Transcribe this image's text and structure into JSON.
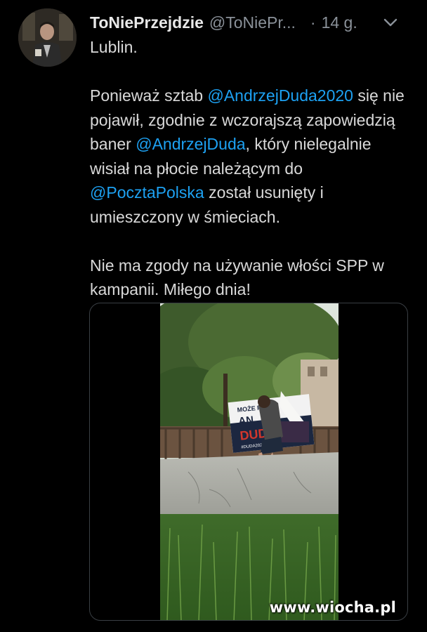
{
  "author": {
    "display_name": "ToNiePrzejdzie",
    "handle": "@ToNiePr...",
    "separator": "·",
    "time": "14 g."
  },
  "tweet": {
    "line1": "Lublin.",
    "para2_part1": "Ponieważ sztab ",
    "mention1": "@AndrzejDuda2020",
    "para2_part2": " się nie pojawił, zgodnie z wczorajszą zapowiedzią baner ",
    "mention2": "@AndrzejDuda",
    "para2_part3": ", który nielegalnie wisiał na płocie należącym do ",
    "mention3": "@PocztaPolska",
    "para2_part4": " został usunięty i umieszczony w śmieciach.",
    "para3": "Nie ma zgody na używanie włości SPP w kampanii. Miłego dnia!"
  },
  "media": {
    "banner_text_top": "MOŻE PREZ",
    "banner_text_mid": "AN",
    "banner_text_name": "DUD",
    "banner_hashtag": "#DUDA2020"
  },
  "watermark": "www.wiocha.pl",
  "colors": {
    "background": "#000000",
    "text": "#d9d9d9",
    "secondary": "#8a9199",
    "mention": "#1da1f2"
  },
  "icons": {
    "menu": "chevron-down-icon"
  }
}
